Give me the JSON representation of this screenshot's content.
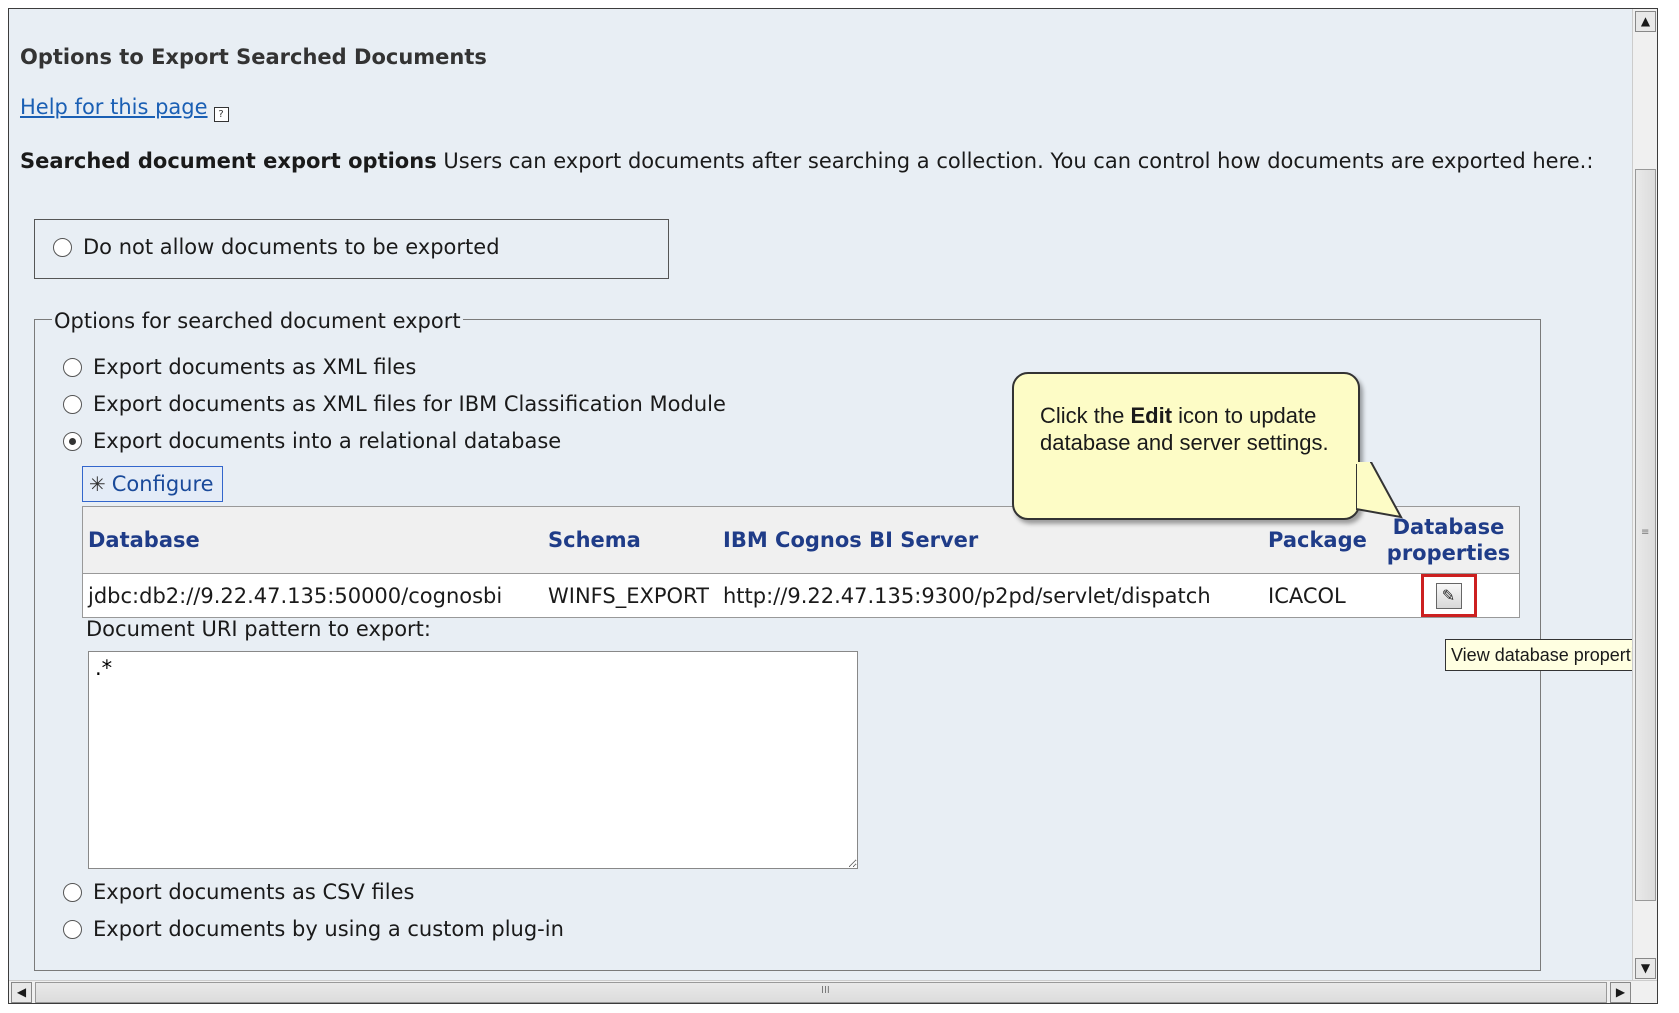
{
  "page": {
    "title": "Options to Export Searched Documents",
    "help_link": "Help for this page",
    "help_icon": "?",
    "desc_bold": "Searched document export options",
    "desc_text": " Users can export documents after searching a collection. You can control how documents are exported here.:"
  },
  "no_export": {
    "label": "Do not allow documents to be exported",
    "checked": false
  },
  "fieldset": {
    "legend": "Options for searched document export",
    "options": [
      {
        "label": "Export documents as XML files",
        "checked": false
      },
      {
        "label": "Export documents as XML files for IBM Classification Module",
        "checked": false
      },
      {
        "label": "Export documents into a relational database",
        "checked": true
      },
      {
        "label": "Export documents as CSV files",
        "checked": false
      },
      {
        "label": "Export documents by using a custom plug-in",
        "checked": false
      }
    ],
    "configure_label": "Configure",
    "configure_icon": "✳",
    "table": {
      "headers": [
        "Database",
        "Schema",
        "IBM Cognos BI Server",
        "Package",
        "Database",
        "properties"
      ],
      "row": {
        "database": "jdbc:db2://9.22.47.135:50000/cognosbi",
        "schema": "WINFS_EXPORT",
        "server": "http://9.22.47.135:9300/p2pd/servlet/dispatch",
        "package": "ICACOL",
        "edit_icon": "✎"
      }
    },
    "uri_label": "Document URI pattern to export:",
    "uri_value": ".*"
  },
  "callout": {
    "before": "Click the ",
    "bold": "Edit",
    "after": " icon to update database and server settings."
  },
  "tooltip": "View database properties",
  "scroll_glyphs": {
    "up": "▲",
    "down": "▼",
    "left": "◀",
    "right": "▶",
    "vgrip": "≡",
    "hgrip": "III"
  },
  "colors": {
    "accent": "#1f3c88",
    "highlight": "#cc2020",
    "callout_bg": "#fdfcc6"
  }
}
